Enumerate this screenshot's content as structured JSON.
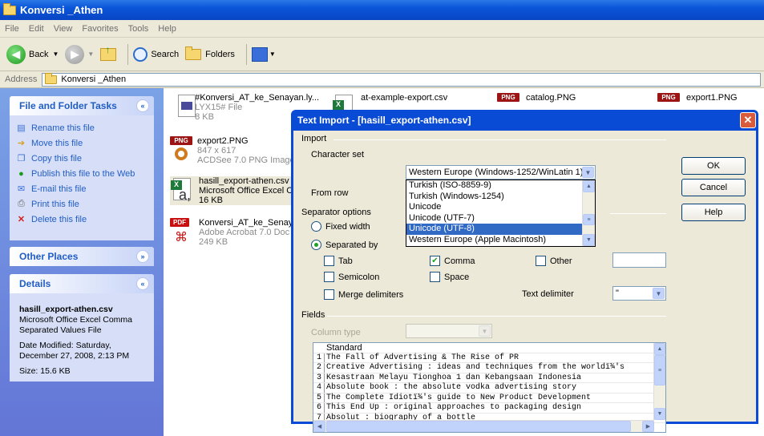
{
  "window": {
    "title": "Konversi _Athen"
  },
  "menu": [
    "File",
    "Edit",
    "View",
    "Favorites",
    "Tools",
    "Help"
  ],
  "toolbar": {
    "back": "Back",
    "search": "Search",
    "folders": "Folders"
  },
  "address": {
    "label": "Address",
    "value": "Konversi _Athen"
  },
  "sidebar": {
    "tasks_title": "File and Folder Tasks",
    "tasks": [
      "Rename this file",
      "Move this file",
      "Copy this file",
      "Publish this file to the Web",
      "E-mail this file",
      "Print this file",
      "Delete this file"
    ],
    "other_title": "Other Places",
    "details_title": "Details",
    "details": {
      "name": "hasill_export-athen.csv",
      "type": "Microsoft Office Excel Comma Separated Values File",
      "modified": "Date Modified: Saturday, December 27, 2008, 2:13 PM",
      "size": "Size: 15.6 KB"
    }
  },
  "files": [
    {
      "name": "#Konversi_AT_ke_Senayan.ly...",
      "meta1": "LYX15# File",
      "meta2": "8 KB"
    },
    {
      "name": "at-example-export.csv",
      "meta1": "",
      "meta2": ""
    },
    {
      "name": "catalog.PNG",
      "meta1": "",
      "meta2": ""
    },
    {
      "name": "export1.PNG",
      "meta1": "",
      "meta2": ""
    },
    {
      "name": "export2.PNG",
      "meta1": "847 x 617",
      "meta2": "ACDSee 7.0 PNG Image"
    },
    {
      "name": "hasill_export-athen.csv",
      "meta1": "Microsoft Office Excel C",
      "meta2": "16 KB"
    },
    {
      "name": "Konversi_AT_ke_Senay",
      "meta1": "Adobe Acrobat 7.0 Doc",
      "meta2": "249 KB"
    }
  ],
  "icons": {
    "png": "PNG",
    "pdf": "PDF"
  },
  "dialog": {
    "title": "Text Import - [hasill_export-athen.csv]",
    "import_label": "Import",
    "charset_label": "Character set",
    "charset_value": "Western Europe (Windows-1252/WinLatin 1)",
    "charset_options": [
      "Turkish (ISO-8859-9)",
      "Turkish (Windows-1254)",
      "Unicode",
      "Unicode (UTF-7)",
      "Unicode (UTF-8)",
      "Western Europe (Apple Macintosh)"
    ],
    "charset_selected_index": 4,
    "from_row_label": "From row",
    "separator_label": "Separator options",
    "fixed_width": "Fixed width",
    "separated_by": "Separated by",
    "tab": "Tab",
    "comma": "Comma",
    "other": "Other",
    "semicolon": "Semicolon",
    "space": "Space",
    "merge": "Merge delimiters",
    "text_delim_label": "Text delimiter",
    "text_delim_value": "\"",
    "fields_label": "Fields",
    "column_type_label": "Column type",
    "ok": "OK",
    "cancel": "Cancel",
    "help": "Help",
    "preview_header": "Standard",
    "preview_rows": [
      {
        "n": "1",
        "t": "The Fall of Advertising & The Rise of PR"
      },
      {
        "n": "2",
        "t": "Creative Advertising : ideas and techniques from the worldï¾'s"
      },
      {
        "n": "3",
        "t": "Kesastraan Melayu Tionghoa 1 dan  Kebangsaan Indonesia"
      },
      {
        "n": "4",
        "t": "Absolute book : the absolute vodka advertising story"
      },
      {
        "n": "5",
        "t": "The Complete Idiotï¾'s guide to New Product Development"
      },
      {
        "n": "6",
        "t": "This End Up : original approaches to packaging design"
      },
      {
        "n": "7",
        "t": "Absolut : biography of a bottle"
      }
    ]
  }
}
